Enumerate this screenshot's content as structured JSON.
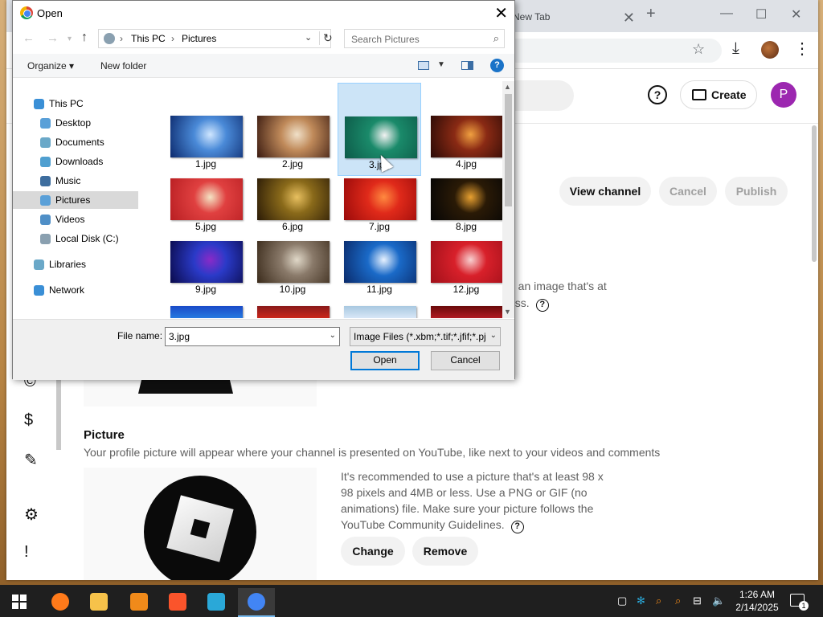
{
  "browser": {
    "tab_label": "New Tab",
    "tab_close": "✕",
    "new_tab": "+",
    "window_min": "—",
    "window_max": "☐",
    "window_close": "✕"
  },
  "youtube": {
    "create_label": "Create",
    "help_label": "?",
    "profile_initial": "P",
    "view_channel": "View channel",
    "cancel": "Cancel",
    "publish": "Publish",
    "banner_fragment_1": "e an image that's at",
    "banner_fragment_2": "ess.",
    "picture_title": "Picture",
    "picture_desc": "Your profile picture will appear where your channel is presented on YouTube, like next to your videos and comments",
    "picture_rec": "It's recommended to use a picture that's at least 98 x 98 pixels and 4MB or less. Use a PNG or GIF (no animations) file. Make sure your picture follows the YouTube Community Guidelines.",
    "change": "Change",
    "remove": "Remove"
  },
  "dialog": {
    "title": "Open",
    "close": "✕",
    "breadcrumb": [
      "This PC",
      "Pictures"
    ],
    "search_placeholder": "Search Pictures",
    "organize": "Organize ▾",
    "new_folder": "New folder",
    "help": "?",
    "nav_items": [
      {
        "label": "This PC",
        "icon": "computer-icon",
        "color": "#3a8fd6"
      },
      {
        "label": "Desktop",
        "icon": "desktop-icon",
        "color": "#5aa0d8"
      },
      {
        "label": "Documents",
        "icon": "documents-icon",
        "color": "#6aa8c8"
      },
      {
        "label": "Downloads",
        "icon": "downloads-icon",
        "color": "#4f9fd0"
      },
      {
        "label": "Music",
        "icon": "music-icon",
        "color": "#3d6d9e"
      },
      {
        "label": "Pictures",
        "icon": "pictures-icon",
        "color": "#5aa0d8"
      },
      {
        "label": "Videos",
        "icon": "videos-icon",
        "color": "#4f8fc7"
      },
      {
        "label": "Local Disk (C:)",
        "icon": "disk-icon",
        "color": "#8aa0b0"
      },
      {
        "label": "Libraries",
        "icon": "libraries-icon",
        "color": "#6aa8c8"
      },
      {
        "label": "Network",
        "icon": "network-icon",
        "color": "#3a8fd6"
      }
    ],
    "selected_nav": "Pictures",
    "files": [
      {
        "name": "1.jpg",
        "colors": [
          "#0c2a6e",
          "#4a8ad8",
          "#cfe6ff"
        ]
      },
      {
        "name": "2.jpg",
        "colors": [
          "#3a1a10",
          "#c08a5a",
          "#f0e0c8"
        ]
      },
      {
        "name": "3.jpg",
        "colors": [
          "#0d5a48",
          "#1a8a6a",
          "#f2f2f2"
        ]
      },
      {
        "name": "4.jpg",
        "colors": [
          "#2a0a06",
          "#8a2a14",
          "#f0a040"
        ]
      },
      {
        "name": "5.jpg",
        "colors": [
          "#b81e22",
          "#e04040",
          "#f4e4c4"
        ]
      },
      {
        "name": "6.jpg",
        "colors": [
          "#2a1a06",
          "#8a6a1a",
          "#e8c060"
        ]
      },
      {
        "name": "7.jpg",
        "colors": [
          "#9a0a0a",
          "#e02a1a",
          "#ff8a40"
        ]
      },
      {
        "name": "8.jpg",
        "colors": [
          "#050505",
          "#2a1a06",
          "#e8a030"
        ]
      },
      {
        "name": "9.jpg",
        "colors": [
          "#0a0a4a",
          "#2a3ac8",
          "#8a2ac8"
        ]
      },
      {
        "name": "10.jpg",
        "colors": [
          "#3a2a1a",
          "#8a7a6a",
          "#e0d8c8"
        ]
      },
      {
        "name": "11.jpg",
        "colors": [
          "#0a2a6a",
          "#1a6ac8",
          "#e8f2ff"
        ]
      },
      {
        "name": "12.jpg",
        "colors": [
          "#a0101a",
          "#d8202a",
          "#f8d0d0"
        ]
      }
    ],
    "partial_row": [
      {
        "colors": [
          "#1a4ac8",
          "#2a8ae8"
        ]
      },
      {
        "colors": [
          "#8a1a1a",
          "#e02a1a"
        ]
      },
      {
        "colors": [
          "#a8c8e0",
          "#e8f2ff"
        ]
      },
      {
        "colors": [
          "#6a0a0a",
          "#c8202a"
        ]
      }
    ],
    "selected_file": "3.jpg",
    "file_name_label": "File name:",
    "file_name_value": "3.jpg",
    "file_type": "Image Files (*.xbm;*.tif;*.jfif;*.pj",
    "open": "Open",
    "cancel": "Cancel"
  },
  "taskbar": {
    "apps": [
      {
        "name": "firefox",
        "color": "#ff7a1a"
      },
      {
        "name": "file-explorer",
        "color": "#f6c24a"
      },
      {
        "name": "search-app",
        "color": "#f08a1a"
      },
      {
        "name": "brave",
        "color": "#fb542b"
      },
      {
        "name": "vscode",
        "color": "#2aa8d8"
      },
      {
        "name": "chrome",
        "color": "#4285f4"
      }
    ],
    "active_app": "chrome",
    "time": "1:26 AM",
    "date": "2/14/2025",
    "notif_count": "1"
  }
}
